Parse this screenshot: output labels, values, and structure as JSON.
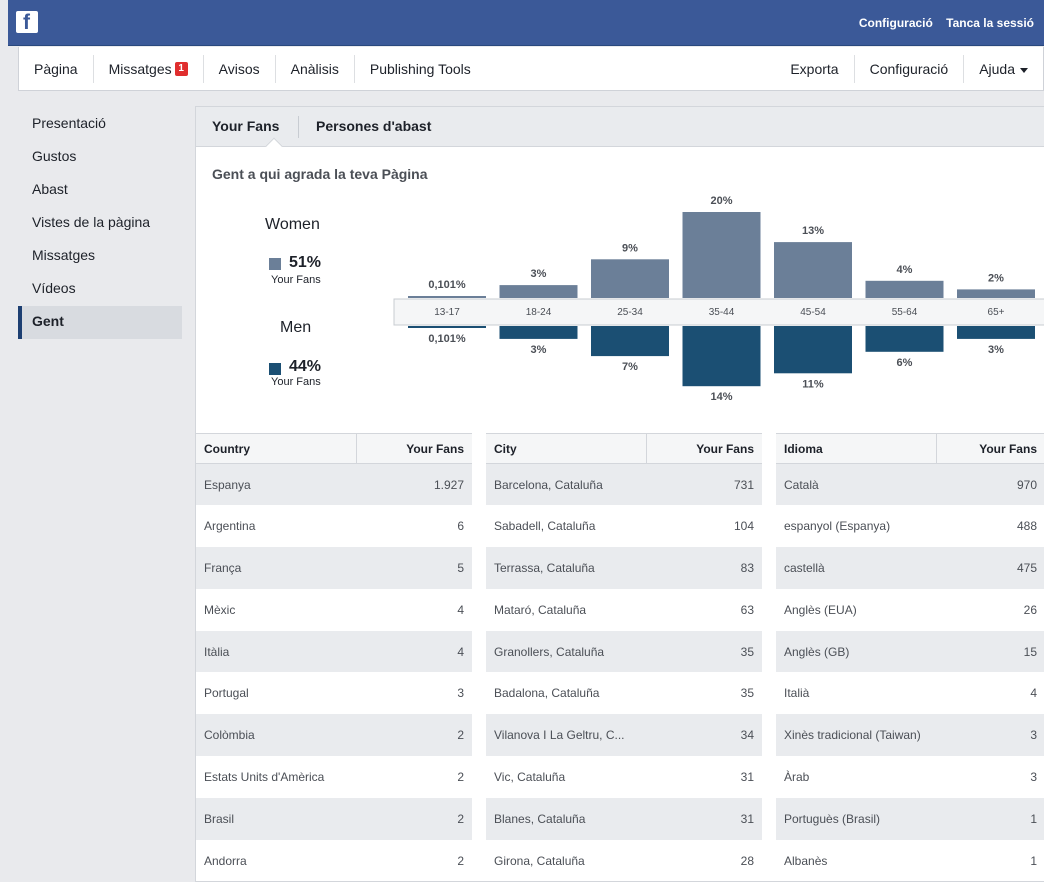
{
  "topbar": {
    "logo": "f",
    "settings": "Configuració",
    "logout": "Tanca la sessió"
  },
  "nav": {
    "left": [
      "Pàgina",
      "Missatges",
      "Avisos",
      "Anàlisis",
      "Publishing Tools"
    ],
    "messages_badge": "1",
    "right": [
      "Exporta",
      "Configuració",
      "Ajuda"
    ]
  },
  "sidebar": {
    "items": [
      "Presentació",
      "Gustos",
      "Abast",
      "Vistes de la pàgina",
      "Missatges",
      "Vídeos",
      "Gent"
    ],
    "active": "Gent"
  },
  "tabs": {
    "your_fans": "Your Fans",
    "reach": "Persones d'abast"
  },
  "section_title": "Gent a qui agrada la teva Pàgina",
  "legend": {
    "women_title": "Women",
    "women_pct": "51%",
    "women_sub": "Your Fans",
    "men_title": "Men",
    "men_pct": "44%",
    "men_sub": "Your Fans"
  },
  "colors": {
    "women": "#6b7f98",
    "men": "#1b4f73",
    "accent": "#3b5998"
  },
  "chart_data": {
    "type": "bar",
    "categories": [
      "13-17",
      "18-24",
      "25-34",
      "35-44",
      "45-54",
      "55-64",
      "65+"
    ],
    "series": [
      {
        "name": "Women",
        "values": [
          0.101,
          3,
          9,
          20,
          13,
          4,
          2
        ],
        "labels": [
          "0,101%",
          "3%",
          "9%",
          "20%",
          "13%",
          "4%",
          "2%"
        ]
      },
      {
        "name": "Men",
        "values": [
          0.101,
          3,
          7,
          14,
          11,
          6,
          3
        ],
        "labels": [
          "0,101%",
          "3%",
          "7%",
          "14%",
          "11%",
          "6%",
          "3%"
        ]
      }
    ]
  },
  "tables": {
    "country": {
      "headers": [
        "Country",
        "Your Fans"
      ],
      "rows": [
        [
          "Espanya",
          "1.927"
        ],
        [
          "Argentina",
          "6"
        ],
        [
          "França",
          "5"
        ],
        [
          "Mèxic",
          "4"
        ],
        [
          "Itàlia",
          "4"
        ],
        [
          "Portugal",
          "3"
        ],
        [
          "Colòmbia",
          "2"
        ],
        [
          "Estats Units d'Amèrica",
          "2"
        ],
        [
          "Brasil",
          "2"
        ],
        [
          "Andorra",
          "2"
        ]
      ]
    },
    "city": {
      "headers": [
        "City",
        "Your Fans"
      ],
      "rows": [
        [
          "Barcelona, Cataluña",
          "731"
        ],
        [
          "Sabadell, Cataluña",
          "104"
        ],
        [
          "Terrassa, Cataluña",
          "83"
        ],
        [
          "Mataró, Cataluña",
          "63"
        ],
        [
          "Granollers, Cataluña",
          "35"
        ],
        [
          "Badalona, Cataluña",
          "35"
        ],
        [
          "Vilanova I La Geltru, C...",
          "34"
        ],
        [
          "Vic, Cataluña",
          "31"
        ],
        [
          "Blanes, Cataluña",
          "31"
        ],
        [
          "Girona, Cataluña",
          "28"
        ]
      ]
    },
    "language": {
      "headers": [
        "Idioma",
        "Your Fans"
      ],
      "rows": [
        [
          "Català",
          "970"
        ],
        [
          "espanyol (Espanya)",
          "488"
        ],
        [
          "castellà",
          "475"
        ],
        [
          "Anglès (EUA)",
          "26"
        ],
        [
          "Anglès (GB)",
          "15"
        ],
        [
          "Italià",
          "4"
        ],
        [
          "Xinès tradicional (Taiwan)",
          "3"
        ],
        [
          "Àrab",
          "3"
        ],
        [
          "Portuguès (Brasil)",
          "1"
        ],
        [
          "Albanès",
          "1"
        ]
      ]
    }
  }
}
